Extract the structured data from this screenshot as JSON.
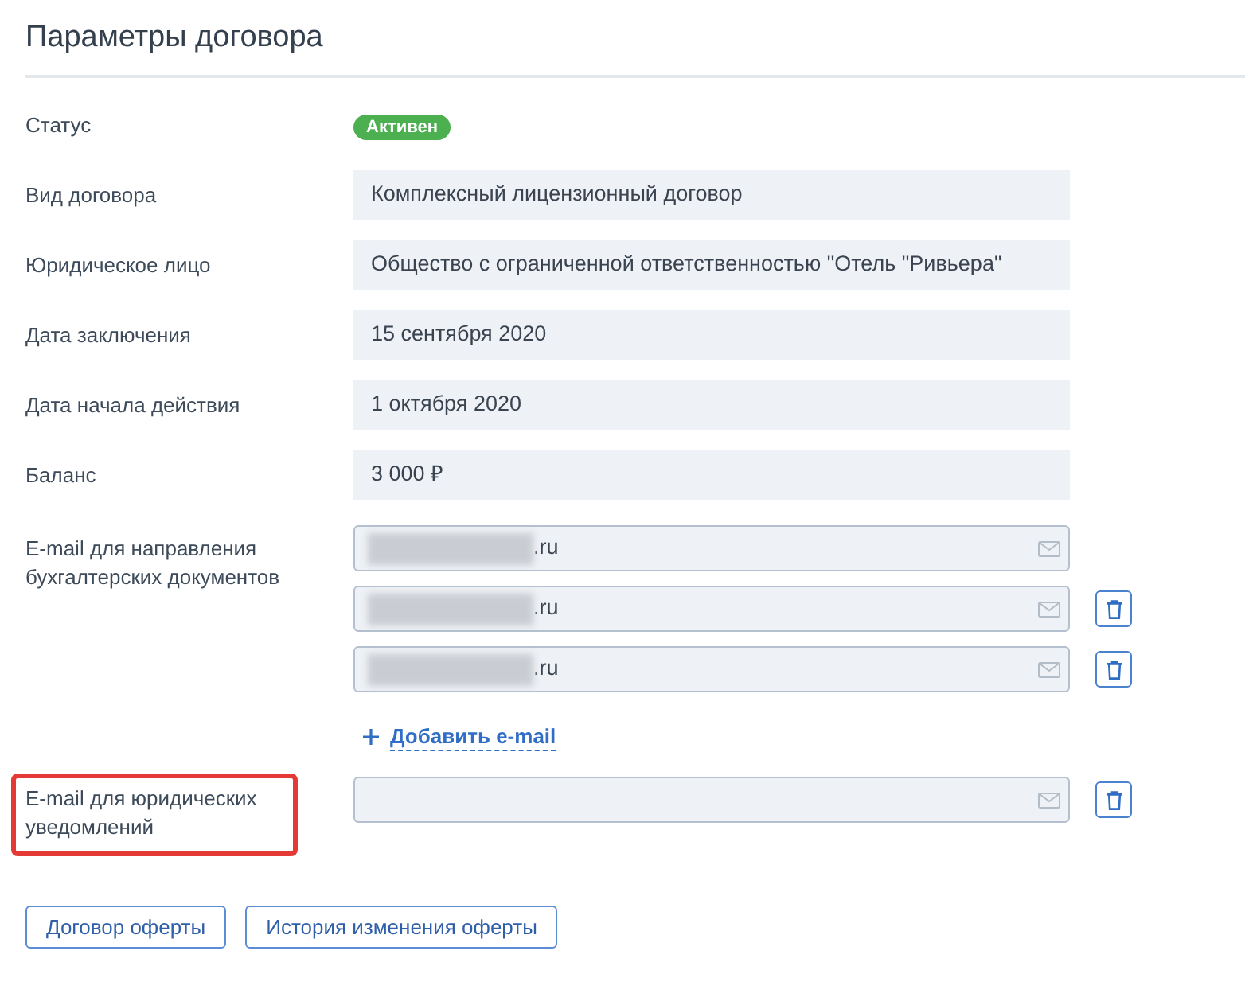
{
  "title": "Параметры договора",
  "fields": [
    {
      "kind": "badge",
      "label": "Статус",
      "value": "Активен"
    },
    {
      "kind": "text",
      "label": "Вид договора",
      "value": "Комплексный лицензионный договор"
    },
    {
      "kind": "text",
      "label": "Юридическое лицо",
      "value": "Общество с ограниченной ответственностью \"Отель \"Ривьера\""
    },
    {
      "kind": "text",
      "label": "Дата заключения",
      "value": "15 сентября 2020"
    },
    {
      "kind": "text",
      "label": "Дата начала действия",
      "value": "1 октября 2020"
    },
    {
      "kind": "text",
      "label": "Баланс",
      "value": "3 000 ₽"
    },
    {
      "kind": "email_list",
      "label": "E-mail для направления бухгалтерских документов",
      "highlighted": false,
      "emails": [
        {
          "value": ".ru",
          "redacted": true,
          "removable": false
        },
        {
          "value": ".ru",
          "redacted": true,
          "removable": true
        },
        {
          "value": ".ru",
          "redacted": true,
          "removable": true
        }
      ],
      "add_link": "Добавить e-mail"
    },
    {
      "kind": "email_list",
      "label": "E-mail для юридических уведомлений",
      "highlighted": true,
      "emails": [
        {
          "removable": true
        }
      ]
    }
  ],
  "buttons": [
    "Договор оферты",
    "История изменения оферты"
  ]
}
